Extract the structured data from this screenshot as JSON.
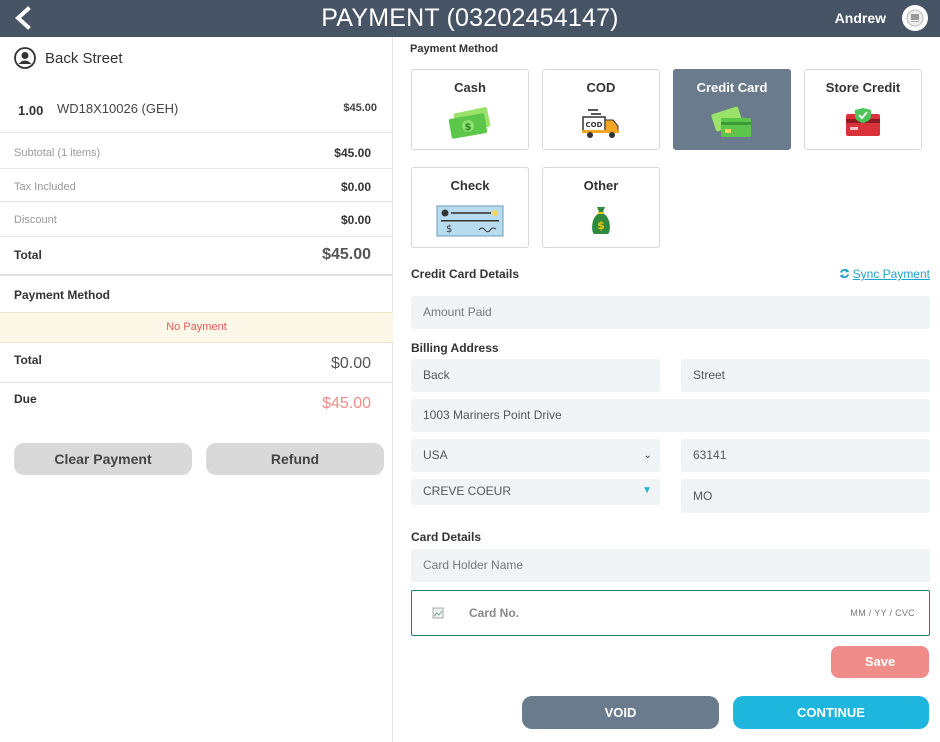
{
  "header": {
    "title": "PAYMENT (03202454147)",
    "user_name": "Andrew"
  },
  "left": {
    "customer_name": "Back Street",
    "line_item": {
      "qty": "1.00",
      "name": "WD18X10026 (GEH)",
      "price": "$45.00"
    },
    "subtotal": {
      "label": "Subtotal (1 items)",
      "value": "$45.00"
    },
    "tax": {
      "label": "Tax Included",
      "value": "$0.00"
    },
    "discount": {
      "label": "Discount",
      "value": "$0.00"
    },
    "total": {
      "label": "Total",
      "value": "$45.00"
    },
    "payment_method_title": "Payment Method",
    "no_payment": "No Payment",
    "paid_total": {
      "label": "Total",
      "value": "$0.00"
    },
    "due": {
      "label": "Due",
      "value": "$45.00"
    },
    "clear_payment_label": "Clear Payment",
    "refund_label": "Refund"
  },
  "right": {
    "payment_method_title": "Payment Method",
    "methods": [
      {
        "label": "Cash",
        "icon": "cash-icon",
        "active": false
      },
      {
        "label": "COD",
        "icon": "delivery-truck-icon",
        "active": false
      },
      {
        "label": "Credit Card",
        "icon": "credit-card-icon",
        "active": true
      },
      {
        "label": "Store Credit",
        "icon": "store-credit-icon",
        "active": false
      },
      {
        "label": "Check",
        "icon": "check-icon",
        "active": false
      },
      {
        "label": "Other",
        "icon": "money-bag-icon",
        "active": false
      }
    ],
    "credit_card_details_title": "Credit Card Details",
    "sync_label": "Sync Payment",
    "amount_paid_placeholder": "Amount Paid",
    "billing_address_title": "Billing Address",
    "first_name": "Back",
    "last_name": "Street",
    "address": "1003 Mariners Point Drive",
    "country": "USA",
    "zip": "63141",
    "city": "CREVE COEUR",
    "state": "MO",
    "card_details_title": "Card Details",
    "card_holder_placeholder": "Card Holder Name",
    "card_no_placeholder": "Card No.",
    "card_exp_placeholder": "MM / YY  / CVC",
    "save_label": "Save",
    "void_label": "VOID",
    "continue_label": "CONTINUE"
  },
  "colors": {
    "header_bg": "#475466",
    "active_card": "#6a7b8d",
    "due_color": "#f08d8a",
    "accent": "#1eb6dc"
  }
}
